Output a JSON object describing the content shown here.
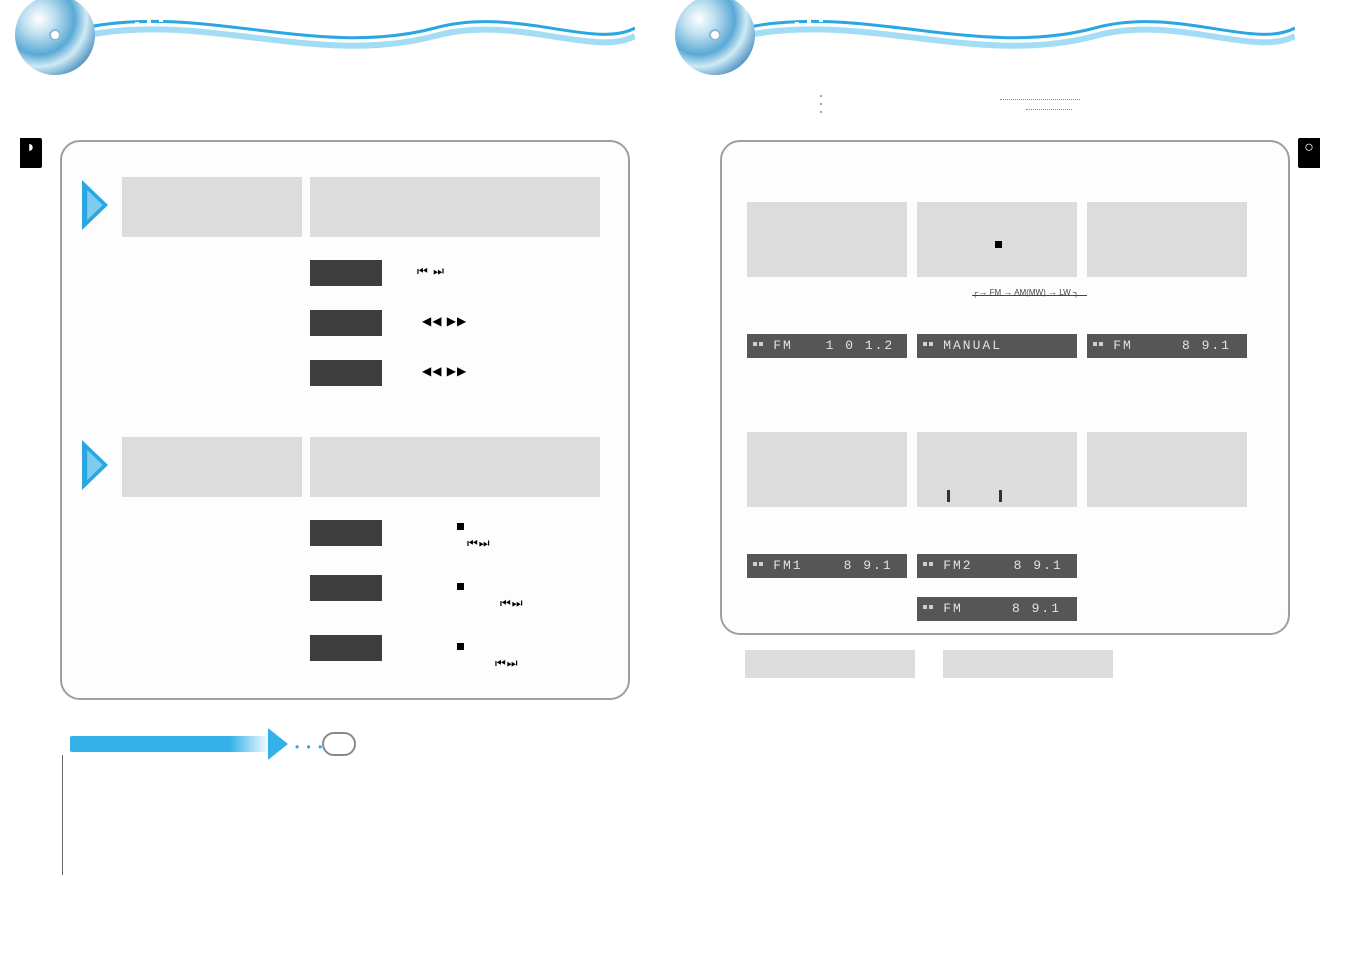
{
  "domain": "Document",
  "left_page": {
    "side_tab_symbol": "◗",
    "section1": {
      "row_a_label": "",
      "row_b_label": "",
      "btn1": "",
      "btn2": "",
      "btn3": "",
      "sym1": "⏮ ⏭",
      "sym2": "◀◀ ▶▶",
      "sym3": "◀◀ ▶▶"
    },
    "section2": {
      "row_a_label": "",
      "row_b_label": "",
      "btn1": "",
      "btn2": "",
      "btn3": "",
      "sym1_stop": "■",
      "sym1_skip": "⏮⏭",
      "sym2_stop": "■",
      "sym2_skip": "⏮⏭",
      "sym3_stop": "■",
      "sym3_skip": "⏮⏭"
    },
    "note_label": ""
  },
  "right_page": {
    "side_tab_symbol": "○",
    "sublabels": {
      "l1": "",
      "l2": ""
    },
    "band_cycle": {
      "fm": "FM",
      "am": "AM(MW)",
      "lw": "LW"
    },
    "row1": {
      "lcd1_band": "FM",
      "lcd1_freq": "1 0 1.2 1",
      "lcd2_text": "MANUAL",
      "lcd3_band": "FM",
      "lcd3_freq": "8 9.1 0"
    },
    "row2": {
      "lcd1_band": "FM1",
      "lcd1_freq": "8 9.1 0",
      "lcd2a_band": "FM2",
      "lcd2a_freq": "8 9.1 0",
      "lcd2b_band": "FM",
      "lcd2b_freq": "8 9.1 0"
    },
    "footer": {
      "l": "",
      "r": ""
    }
  }
}
